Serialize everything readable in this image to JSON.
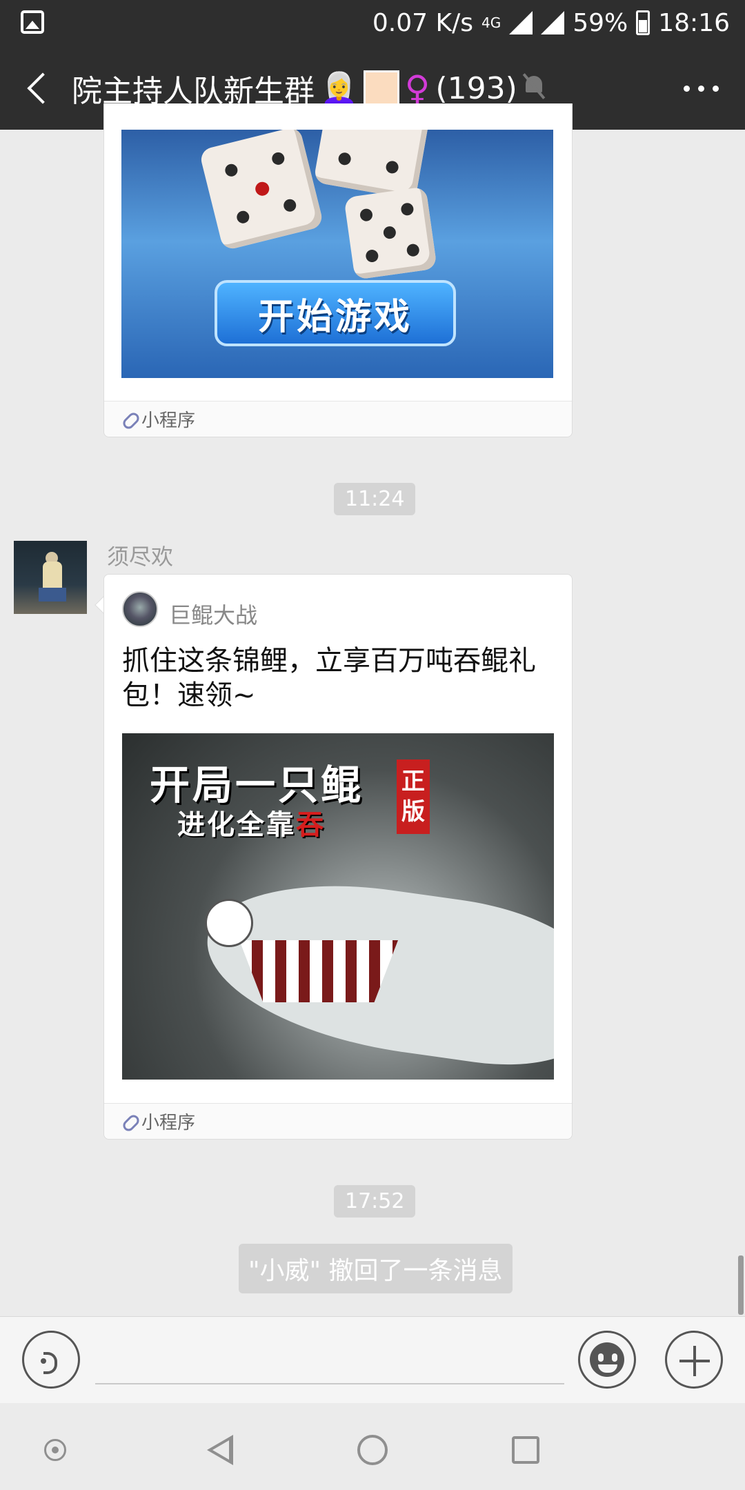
{
  "status": {
    "speed": "0.07 K/s",
    "network": "4G",
    "battery": "59%",
    "time": "18:16"
  },
  "header": {
    "group_name": "院主持人队新生群",
    "emoji": "👩‍🦳",
    "female_symbol": "♀",
    "member_count": "(193)"
  },
  "messages": {
    "mini_program_label": "小程序",
    "first_card": {
      "button_text": "开始游戏"
    },
    "time1": "11:24",
    "sender": "须尽欢",
    "second_card": {
      "app_name": "巨鲲大战",
      "title": "抓住这条锦鲤，立享百万吨吞鲲礼包！速领~",
      "img_line1": "开局一只鲲",
      "img_line2_a": "进化全靠",
      "img_line2_b": "吞",
      "seal_1": "正",
      "seal_2": "版"
    },
    "time2": "17:52",
    "recall_text": "\"小威\" 撤回了一条消息"
  },
  "colors": {
    "dark_bar": "#2e2e2e",
    "chat_bg": "#ebebeb",
    "female_symbol": "#d23bd8"
  },
  "icons": [
    "image-icon",
    "signal-icon",
    "battery-icon",
    "back-icon",
    "mute-icon",
    "more-icon",
    "link-icon",
    "voice-icon",
    "emoji-icon",
    "plus-icon",
    "sysnav-back-icon",
    "sysnav-home-icon",
    "sysnav-recent-icon"
  ]
}
